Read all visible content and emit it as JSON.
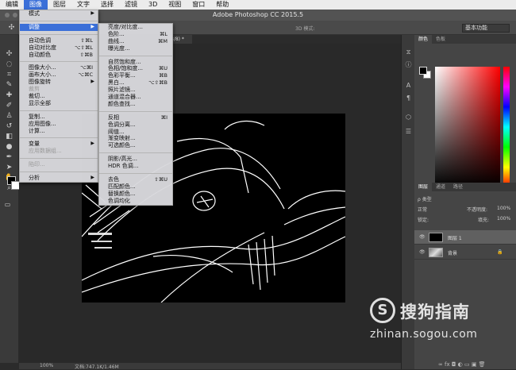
{
  "menubar": {
    "items": [
      "编辑",
      "图像",
      "图层",
      "文字",
      "选择",
      "滤镜",
      "3D",
      "视图",
      "窗口",
      "帮助"
    ],
    "active_index": 1
  },
  "app_title": "Adobe Photoshop CC 2015.5",
  "options_bar": {
    "mode_3d": "3D 模式:",
    "workspace": "基本功能"
  },
  "document_tab": "8/8) *",
  "image_menu": [
    {
      "label": "模式",
      "arrow": "▶"
    },
    {
      "sep": true
    },
    {
      "label": "调整",
      "arrow": "▶",
      "highlight": true
    },
    {
      "sep": true
    },
    {
      "label": "自动色调",
      "shortcut": "⇧⌘L"
    },
    {
      "label": "自动对比度",
      "shortcut": "⌥⇧⌘L"
    },
    {
      "label": "自动颜色",
      "shortcut": "⇧⌘B"
    },
    {
      "sep": true
    },
    {
      "label": "图像大小...",
      "shortcut": "⌥⌘I"
    },
    {
      "label": "画布大小...",
      "shortcut": "⌥⌘C"
    },
    {
      "label": "图像旋转",
      "arrow": "▶"
    },
    {
      "label": "裁剪",
      "disabled": true
    },
    {
      "label": "裁切..."
    },
    {
      "label": "显示全部"
    },
    {
      "sep": true
    },
    {
      "label": "复制..."
    },
    {
      "label": "应用图像..."
    },
    {
      "label": "计算..."
    },
    {
      "sep": true
    },
    {
      "label": "变量",
      "arrow": "▶"
    },
    {
      "label": "应用数据组...",
      "disabled": true
    },
    {
      "sep": true
    },
    {
      "label": "陷印...",
      "disabled": true
    },
    {
      "sep": true
    },
    {
      "label": "分析",
      "arrow": "▶"
    }
  ],
  "adjust_menu": [
    {
      "label": "亮度/对比度..."
    },
    {
      "label": "色阶...",
      "shortcut": "⌘L"
    },
    {
      "label": "曲线...",
      "shortcut": "⌘M"
    },
    {
      "label": "曝光度..."
    },
    {
      "sep": true
    },
    {
      "label": "自然饱和度..."
    },
    {
      "label": "色相/饱和度...",
      "shortcut": "⌘U"
    },
    {
      "label": "色彩平衡...",
      "shortcut": "⌘B"
    },
    {
      "label": "黑白...",
      "shortcut": "⌥⇧⌘B"
    },
    {
      "label": "照片滤镜..."
    },
    {
      "label": "通道混合器..."
    },
    {
      "label": "颜色查找..."
    },
    {
      "sep": true
    },
    {
      "label": "反相",
      "shortcut": "⌘I"
    },
    {
      "label": "色调分离..."
    },
    {
      "label": "阈值..."
    },
    {
      "label": "渐变映射..."
    },
    {
      "label": "可选颜色..."
    },
    {
      "sep": true
    },
    {
      "label": "阴影/高光..."
    },
    {
      "label": "HDR 色调..."
    },
    {
      "sep": true
    },
    {
      "label": "去色",
      "shortcut": "⇧⌘U"
    },
    {
      "label": "匹配颜色..."
    },
    {
      "label": "替换颜色..."
    },
    {
      "label": "色调均化"
    }
  ],
  "color_panel": {
    "tabs": [
      "颜色",
      "色板"
    ],
    "foreground": "#000000",
    "background": "#ffffff"
  },
  "layers_panel": {
    "tabs": [
      "图层",
      "通道",
      "路径"
    ],
    "filter": "ρ 类型",
    "blend_mode": "正常",
    "opacity_label": "不透明度:",
    "opacity_value": "100%",
    "lock_label": "锁定:",
    "fill_label": "填充:",
    "fill_value": "100%",
    "layers": [
      {
        "name": "图层 1",
        "selected": true
      },
      {
        "name": "背景",
        "locked": true
      }
    ],
    "bottom_buttons": "∞  fx  ◘  ◐  ▭  ▣  🗑"
  },
  "status": {
    "zoom": "100%",
    "doc_info": "文档:747.1K/1.46M"
  },
  "watermark": {
    "logo_char": "S",
    "brand": "搜狗指南",
    "url": "zhinan.sogou.com"
  },
  "colors": {
    "accent": "#3a6fd8"
  }
}
